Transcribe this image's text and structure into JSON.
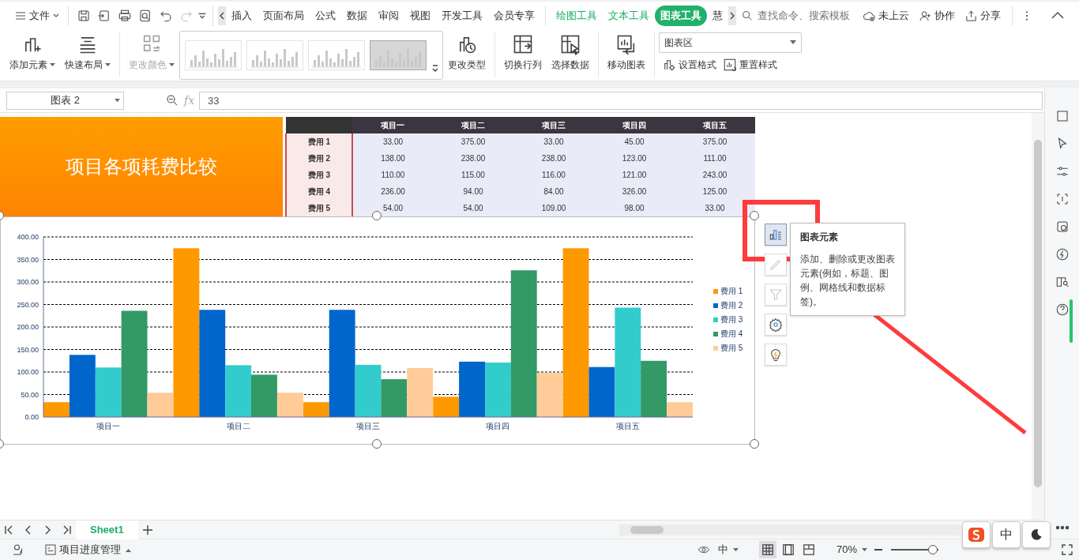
{
  "title_bar": {
    "file_menu": "文件",
    "quick_tools": [
      {
        "disabled": false
      },
      {
        "disabled": false
      },
      {
        "disabled": false
      },
      {
        "disabled": false
      },
      {
        "disabled": false
      },
      {
        "disabled": true
      }
    ],
    "tabs": [
      {
        "label": "插入",
        "kind": "normal",
        "selected": false
      },
      {
        "label": "页面布局",
        "kind": "normal",
        "selected": false
      },
      {
        "label": "公式",
        "kind": "normal",
        "selected": false
      },
      {
        "label": "数据",
        "kind": "normal",
        "selected": false
      },
      {
        "label": "审阅",
        "kind": "normal",
        "selected": false
      },
      {
        "label": "视图",
        "kind": "normal",
        "selected": false
      },
      {
        "label": "开发工具",
        "kind": "normal",
        "selected": false
      },
      {
        "label": "会员专享",
        "kind": "normal",
        "selected": false
      },
      {
        "label": "绘图工具",
        "kind": "context",
        "selected": false
      },
      {
        "label": "文本工具",
        "kind": "context",
        "selected": false
      },
      {
        "label": "图表工具",
        "kind": "context",
        "selected": true
      },
      {
        "label": "慧",
        "kind": "normal",
        "selected": false
      }
    ],
    "search": {
      "placeholder": "查找命令、搜索模板"
    },
    "actions": [
      {
        "label": "未上云"
      },
      {
        "label": "协作"
      },
      {
        "label": "分享"
      }
    ]
  },
  "ribbon": {
    "left_buttons": [
      {
        "label": "添加元素",
        "dropdown": true,
        "disabled": false
      },
      {
        "label": "快速布局",
        "dropdown": true,
        "disabled": false
      },
      {
        "label": "更改颜色",
        "dropdown": true,
        "disabled": true
      }
    ],
    "chart_styles": [
      {
        "selected": false
      },
      {
        "selected": false
      },
      {
        "selected": false
      },
      {
        "selected": true
      }
    ],
    "right_buttons": [
      {
        "label": "更改类型",
        "dropdown": false,
        "disabled": false
      },
      {
        "label": "切换行列",
        "dropdown": false,
        "disabled": false
      },
      {
        "label": "选择数据",
        "dropdown": false,
        "disabled": false
      },
      {
        "label": "移动图表",
        "dropdown": false,
        "disabled": false
      }
    ],
    "element_select": {
      "value": "图表区"
    },
    "format_buttons": [
      {
        "label": "设置格式"
      },
      {
        "label": "重置样式"
      }
    ]
  },
  "formula_bar": {
    "name_box": "图表 2",
    "fx_label": "fx",
    "value": "33"
  },
  "sheet": {
    "title_cell": "项目各项耗费比较",
    "data_table": {
      "columns": [
        "项目一",
        "项目二",
        "项目三",
        "项目四",
        "项目五"
      ],
      "rows": [
        {
          "label": "费用 1",
          "values": [
            "33.00",
            "375.00",
            "33.00",
            "45.00",
            "375.00"
          ]
        },
        {
          "label": "费用 2",
          "values": [
            "138.00",
            "238.00",
            "238.00",
            "123.00",
            "111.00"
          ]
        },
        {
          "label": "费用 3",
          "values": [
            "110.00",
            "115.00",
            "116.00",
            "121.00",
            "243.00"
          ]
        },
        {
          "label": "费用 4",
          "values": [
            "236.00",
            "94.00",
            "84.00",
            "326.00",
            "125.00"
          ]
        },
        {
          "label": "费用 5",
          "values": [
            "54.00",
            "54.00",
            "109.00",
            "98.00",
            "33.00"
          ]
        }
      ]
    },
    "chart": {
      "chart_data": {
        "type": "bar",
        "categories": [
          "项目一",
          "项目二",
          "项目三",
          "项目四",
          "项目五"
        ],
        "series": [
          {
            "name": "费用 1",
            "color": "#ff9900",
            "values": [
              33,
              375,
              33,
              45,
              375
            ]
          },
          {
            "name": "费用 2",
            "color": "#0066cc",
            "values": [
              138,
              238,
              238,
              123,
              111
            ]
          },
          {
            "name": "费用 3",
            "color": "#33cccc",
            "values": [
              110,
              115,
              116,
              121,
              243
            ]
          },
          {
            "name": "费用 4",
            "color": "#339966",
            "values": [
              236,
              94,
              84,
              326,
              125
            ]
          },
          {
            "name": "费用 5",
            "color": "#ffcc99",
            "values": [
              54,
              54,
              109,
              98,
              33
            ]
          }
        ],
        "ylim": [
          0,
          400
        ],
        "grid": true,
        "legend": true,
        "yticks": [
          {
            "value": 0,
            "label": "0.00"
          },
          {
            "value": 50,
            "label": "50.00"
          },
          {
            "value": 100,
            "label": "100.00"
          },
          {
            "value": 150,
            "label": "150.00"
          },
          {
            "value": 200,
            "label": "200.00"
          },
          {
            "value": 250,
            "label": "250.00"
          },
          {
            "value": 300,
            "label": "300.00"
          },
          {
            "value": 350,
            "label": "350.00"
          },
          {
            "value": 400,
            "label": "400.00"
          }
        ]
      }
    },
    "chart_tools": [
      {
        "selected": true,
        "disabled": false
      },
      {
        "selected": false,
        "disabled": true
      },
      {
        "selected": false,
        "disabled": true
      },
      {
        "selected": false,
        "disabled": false
      },
      {
        "selected": false,
        "disabled": false
      }
    ],
    "tooltip": {
      "title": "图表元素",
      "text": "添加、删除或更改图表元素(例如，标题、图例、网格线和数据标签)。"
    }
  },
  "sheet_tabs": [
    {
      "label": "Sheet1",
      "selected": true
    }
  ],
  "status_bar": {
    "document": "项目进度管理",
    "input_mode": "中",
    "views": [
      {
        "selected": true
      },
      {
        "selected": false
      },
      {
        "selected": false
      }
    ],
    "zoom": "70%",
    "zoom_slider": {
      "level": 0.88
    }
  },
  "ime_toolbar": {
    "mode": "中"
  }
}
